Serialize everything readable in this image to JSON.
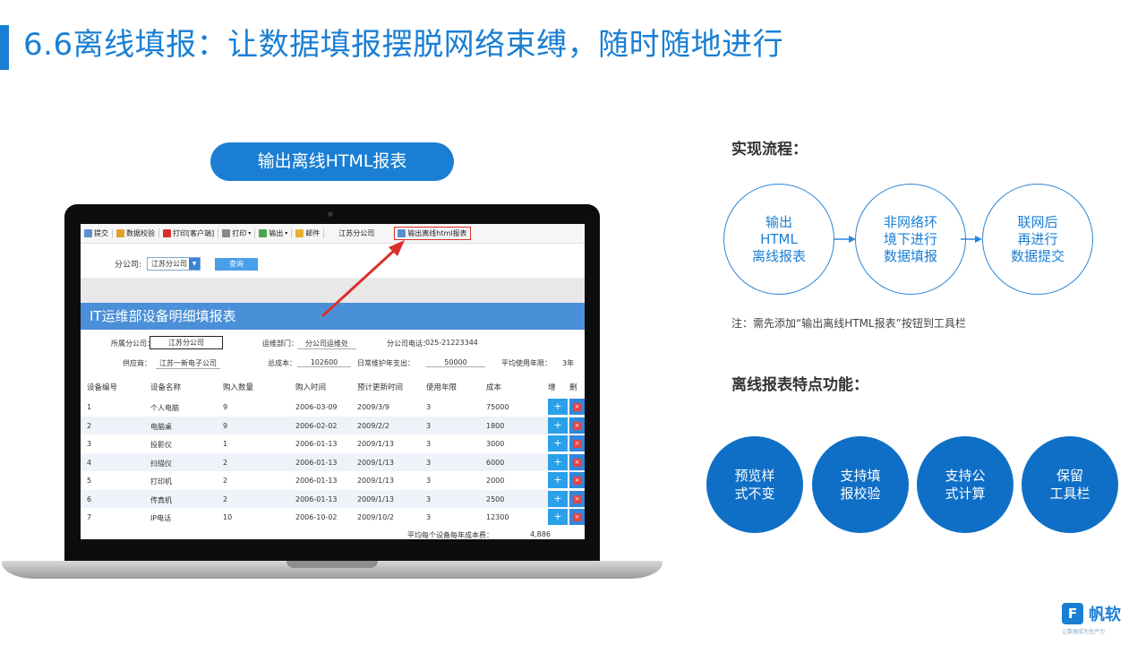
{
  "slide": {
    "title": "6.6离线填报：让数据填报摆脱网络束缚，随时随地进行",
    "export_button": "输出离线HTML报表"
  },
  "toolbar": {
    "submit": "提交",
    "validate": "数据校验",
    "print_client": "打印[客户端]",
    "print": "打印",
    "export": "输出",
    "mail": "邮件",
    "company": "江苏分公司",
    "offline_html": "输出离线html报表"
  },
  "filter": {
    "label": "分公司:",
    "value": "江苏分公司",
    "query": "查询"
  },
  "report": {
    "title": "IT运维部设备明细填报表",
    "info_row1": {
      "company_label": "所属分公司：",
      "company_value": "江苏分公司",
      "dept_label": "运维部门：",
      "dept_value": "分公司运维处",
      "phone_label": "分公司电话：",
      "phone_value": "025-21223344"
    },
    "info_row2": {
      "supplier_label": "供应商：",
      "supplier_value": "江苏一新电子公司",
      "total_label": "总成本：",
      "total_value": "102600",
      "maint_label": "日常维护年支出：",
      "maint_value": "50000",
      "avg_label": "平均使用年限：",
      "avg_value": "3年"
    },
    "columns": [
      "设备编号",
      "设备名称",
      "购入数量",
      "购入时间",
      "预计更新时间",
      "使用年限",
      "成本",
      "增",
      "删"
    ],
    "rows": [
      [
        "1",
        "个人电脑",
        "9",
        "2006-03-09",
        "2009/3/9",
        "3",
        "75000"
      ],
      [
        "2",
        "电脑桌",
        "9",
        "2006-02-02",
        "2009/2/2",
        "3",
        "1800"
      ],
      [
        "3",
        "投影仪",
        "1",
        "2006-01-13",
        "2009/1/13",
        "3",
        "3000"
      ],
      [
        "4",
        "扫描仪",
        "2",
        "2006-01-13",
        "2009/1/13",
        "3",
        "6000"
      ],
      [
        "5",
        "打印机",
        "2",
        "2006-01-13",
        "2009/1/13",
        "3",
        "2000"
      ],
      [
        "6",
        "传真机",
        "2",
        "2006-01-13",
        "2009/1/13",
        "3",
        "2500"
      ],
      [
        "7",
        "IP电话",
        "10",
        "2006-10-02",
        "2009/10/2",
        "3",
        "12300"
      ]
    ],
    "add_glyph": "+",
    "del_glyph": "×",
    "footer_label": "平均每个设备每年成本费：",
    "footer_value": "4,886"
  },
  "process": {
    "title": "实现流程：",
    "steps": [
      {
        "line1": "输出",
        "line2": "HTML",
        "line3": "离线报表"
      },
      {
        "line1": "非网络环",
        "line2": "境下进行",
        "line3": "数据填报"
      },
      {
        "line1": "联网后",
        "line2": "再进行",
        "line3": "数据提交"
      }
    ],
    "note": "注：需先添加“输出离线HTML报表”按钮到工具栏"
  },
  "features": {
    "title": "离线报表特点功能：",
    "items": [
      {
        "line1": "预览样",
        "line2": "式不变"
      },
      {
        "line1": "支持填",
        "line2": "报校验"
      },
      {
        "line1": "支持公",
        "line2": "式计算"
      },
      {
        "line1": "保留",
        "line2": "工具栏"
      }
    ]
  },
  "brand": {
    "mark": "F",
    "name": "帆软",
    "slogan": "让数据成为生产力"
  },
  "colors": {
    "accent": "#1a7fd4",
    "feature_fill": "#0f6fc6",
    "report_header": "#4a90d9",
    "highlight_red": "#d9302b"
  }
}
